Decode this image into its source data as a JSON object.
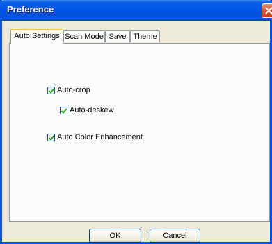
{
  "window": {
    "title": "Preference"
  },
  "tabs": [
    {
      "label": "Auto Settings",
      "active": true
    },
    {
      "label": "Scan Mode",
      "active": false
    },
    {
      "label": "Save",
      "active": false
    },
    {
      "label": "Theme",
      "active": false
    }
  ],
  "options": {
    "auto_crop": {
      "label": "Auto-crop",
      "checked": true
    },
    "auto_deskew": {
      "label": "Auto-deskew",
      "checked": true
    },
    "auto_color": {
      "label": "Auto Color Enhancement",
      "checked": true
    }
  },
  "buttons": {
    "ok": "OK",
    "cancel": "Cancel"
  },
  "colors": {
    "titlebar": "#0058e6",
    "dialog_bg": "#ece9d8",
    "tab_highlight": "#ffc83c",
    "checkmark": "#21a121",
    "close": "#d8562f"
  },
  "icons": {
    "close": "close-icon",
    "check": "checkmark-icon"
  }
}
